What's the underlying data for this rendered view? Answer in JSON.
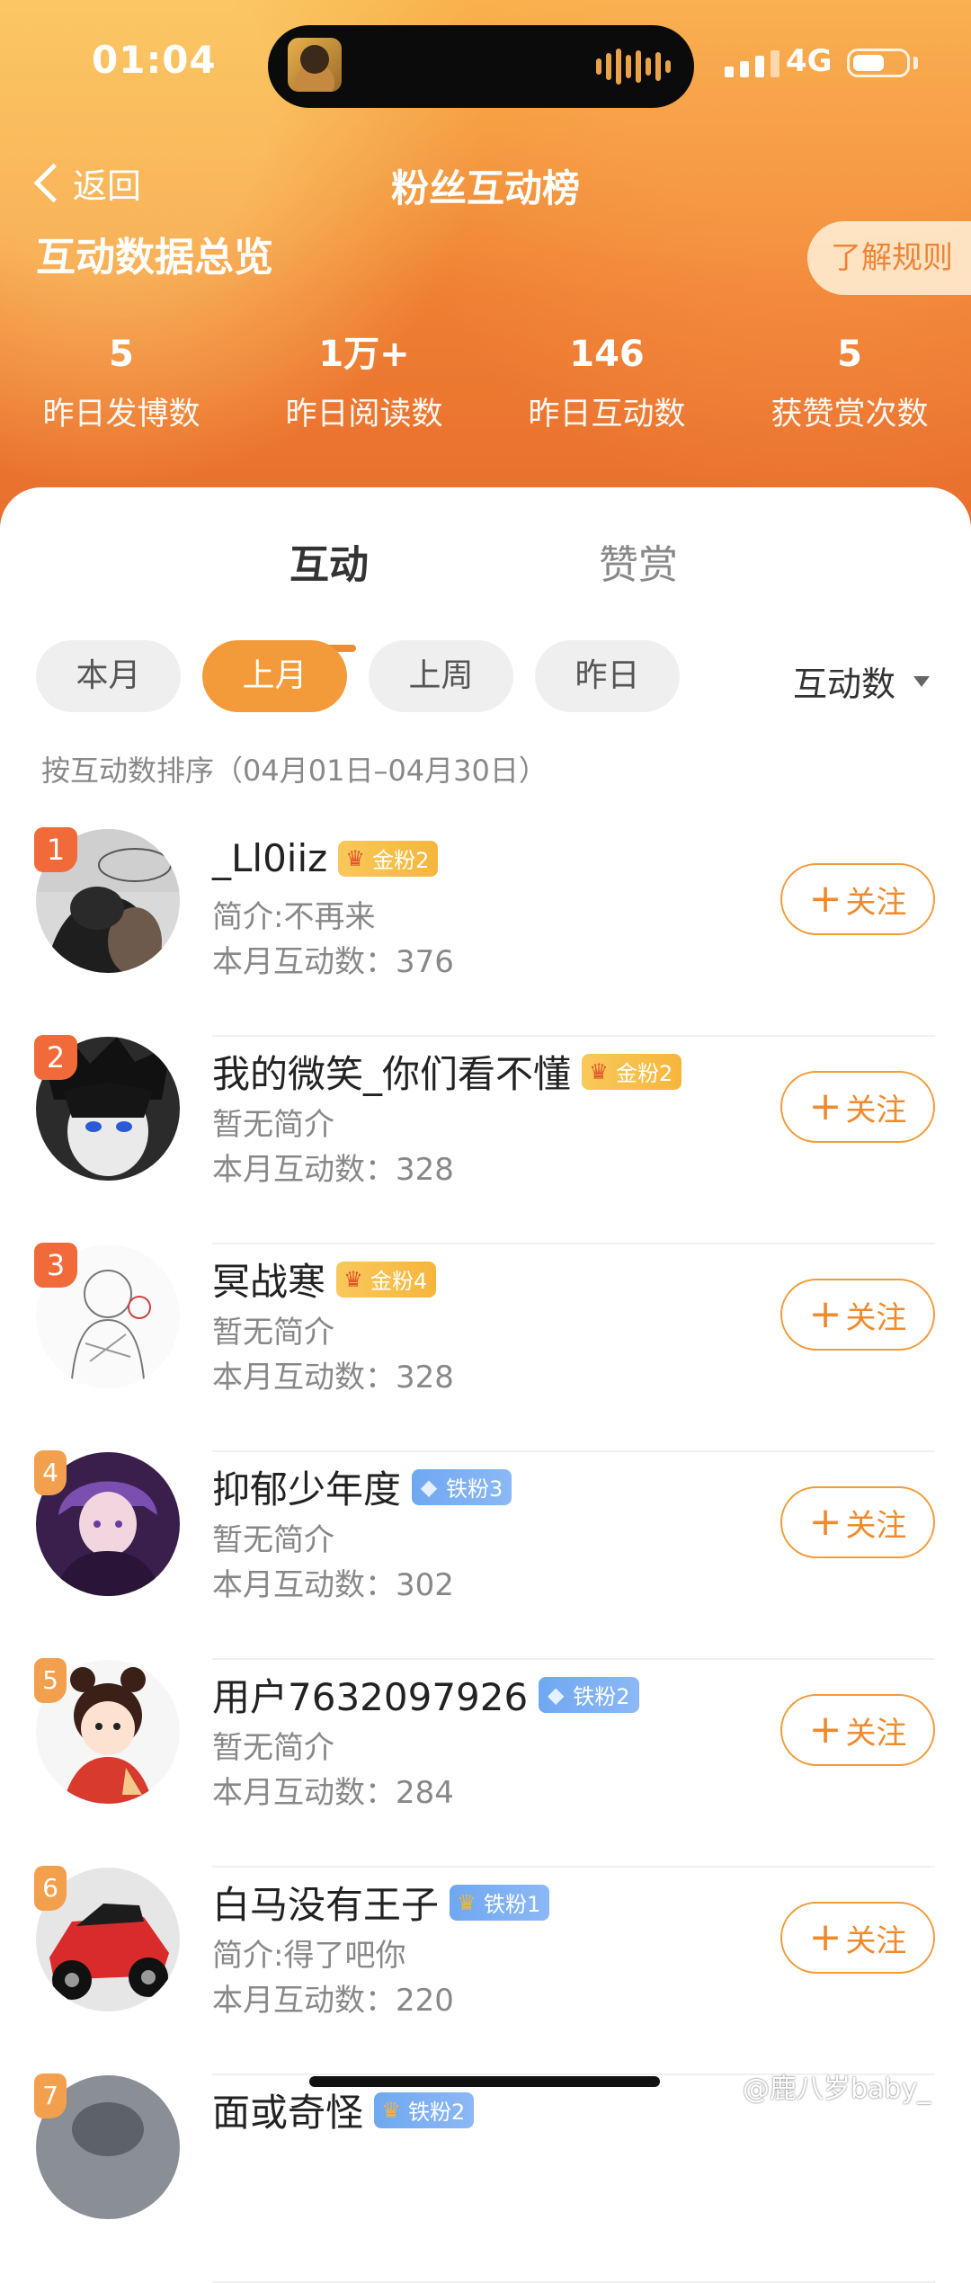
{
  "status_bar": {
    "time": "01:04",
    "network": "4G"
  },
  "nav": {
    "back_label": "返回",
    "title": "粉丝互动榜"
  },
  "overview": {
    "title": "互动数据总览",
    "rules_label": "了解规则",
    "stats": [
      {
        "value": "5",
        "label": "昨日发博数"
      },
      {
        "value": "1万+",
        "label": "昨日阅读数"
      },
      {
        "value": "146",
        "label": "昨日互动数"
      },
      {
        "value": "5",
        "label": "获赞赏次数"
      }
    ]
  },
  "tabs": [
    {
      "label": "互动",
      "active": true
    },
    {
      "label": "赞赏",
      "active": false
    }
  ],
  "filters": [
    {
      "label": "本月",
      "active": false
    },
    {
      "label": "上月",
      "active": true
    },
    {
      "label": "上周",
      "active": false
    },
    {
      "label": "昨日",
      "active": false
    }
  ],
  "sort_label": "互动数",
  "sort_note": "按互动数排序（04月01日–04月30日）",
  "follow_label": "关注",
  "fans": [
    {
      "rank": "1",
      "name": "_Ll0iiz",
      "badge_level": "5",
      "badge_text": "金粉2",
      "badge_type": "gold",
      "bio": "简介:不再来",
      "count_label": "本月互动数：376"
    },
    {
      "rank": "2",
      "name": "我的微笑_你们看不懂",
      "badge_level": "4",
      "badge_text": "金粉2",
      "badge_type": "gold",
      "bio": "暂无简介",
      "count_label": "本月互动数：328"
    },
    {
      "rank": "3",
      "name": "冥战寒",
      "badge_level": "3",
      "badge_text": "金粉4",
      "badge_type": "gold",
      "bio": "暂无简介",
      "count_label": "本月互动数：328"
    },
    {
      "rank": "4",
      "name": "抑郁少年度",
      "badge_level": "",
      "badge_text": "铁粉3",
      "badge_type": "iron",
      "bio": "暂无简介",
      "count_label": "本月互动数：302"
    },
    {
      "rank": "5",
      "name": "用户7632097926",
      "badge_level": "",
      "badge_text": "铁粉2",
      "badge_type": "iron",
      "bio": "暂无简介",
      "count_label": "本月互动数：284"
    },
    {
      "rank": "6",
      "name": "白马没有王子",
      "badge_level": "2",
      "badge_text": "铁粉1",
      "badge_type": "iron",
      "bio": "简介:得了吧你",
      "count_label": "本月互动数：220"
    },
    {
      "rank": "7",
      "name": "面或奇怪",
      "badge_level": "",
      "badge_text": "铁粉2",
      "badge_type": "iron",
      "bio": "",
      "count_label": ""
    }
  ],
  "watermark": "@鹿八岁baby_",
  "colors": {
    "accent": "#F08A2E",
    "header_top": "#F7B34A",
    "header_bottom": "#E96E2E",
    "rank_top": "#F16A3A"
  }
}
